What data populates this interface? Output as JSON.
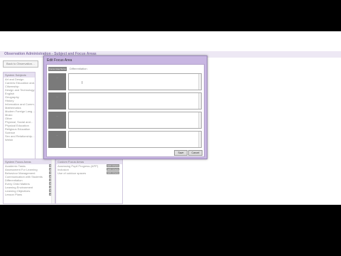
{
  "app": {
    "title": "Observation Administration - Subject and Focus Areas",
    "back_label": "Back to Observation…"
  },
  "system_subjects": {
    "header": "System Subjects",
    "items": [
      "Art and Design",
      "Careers Education and…",
      "Citizenship",
      "Design and Technology",
      "English",
      "Geography",
      "History",
      "Information and Comm…",
      "Mathematics",
      "Modern Foreign Lang…",
      "Music",
      "Other",
      "Physical, Social and…",
      "Physical Education",
      "Religious Education",
      "Science",
      "Sex and Relationship…",
      "Welsh"
    ]
  },
  "system_focus": {
    "header": "System Focus Areas",
    "items": [
      {
        "label": "Academic Tasks",
        "tag": "Edit"
      },
      {
        "label": "Assessment For Learning",
        "tag": "Edit"
      },
      {
        "label": "Behaviour Management",
        "tag": "Edit"
      },
      {
        "label": "Communication with Students",
        "tag": "Edit"
      },
      {
        "label": "Differentiation",
        "tag": "Edit"
      },
      {
        "label": "Every Child Matters",
        "tag": "Edit"
      },
      {
        "label": "Learning Environment",
        "tag": "Edit"
      },
      {
        "label": "Learning Objectives",
        "tag": "Edit"
      },
      {
        "label": "Lesson Plans",
        "tag": "Edit"
      }
    ]
  },
  "custom_focus": {
    "header": "Custom Focus Areas",
    "items": [
      {
        "label": "Assessing Pupil Progress (APP)",
        "tag": "Edit Criteria"
      },
      {
        "label": "Inclusion",
        "tag": "Edit Criteria"
      },
      {
        "label": "Use of outdoor spaces",
        "tag": "Edit Criteria"
      },
      {
        "label": "",
        "tag": "Add new"
      }
    ]
  },
  "dialog": {
    "title": "Edit Focus Area",
    "toolbar_btn1": "Focus Area Name",
    "toolbar_text": "Differentiation",
    "rows": [
      {
        "label": "…"
      },
      {
        "label": "…"
      },
      {
        "label": "…"
      },
      {
        "label": "…"
      }
    ],
    "save_label": "Save",
    "cancel_label": "Cancel",
    "cursor_glyph": "I"
  }
}
